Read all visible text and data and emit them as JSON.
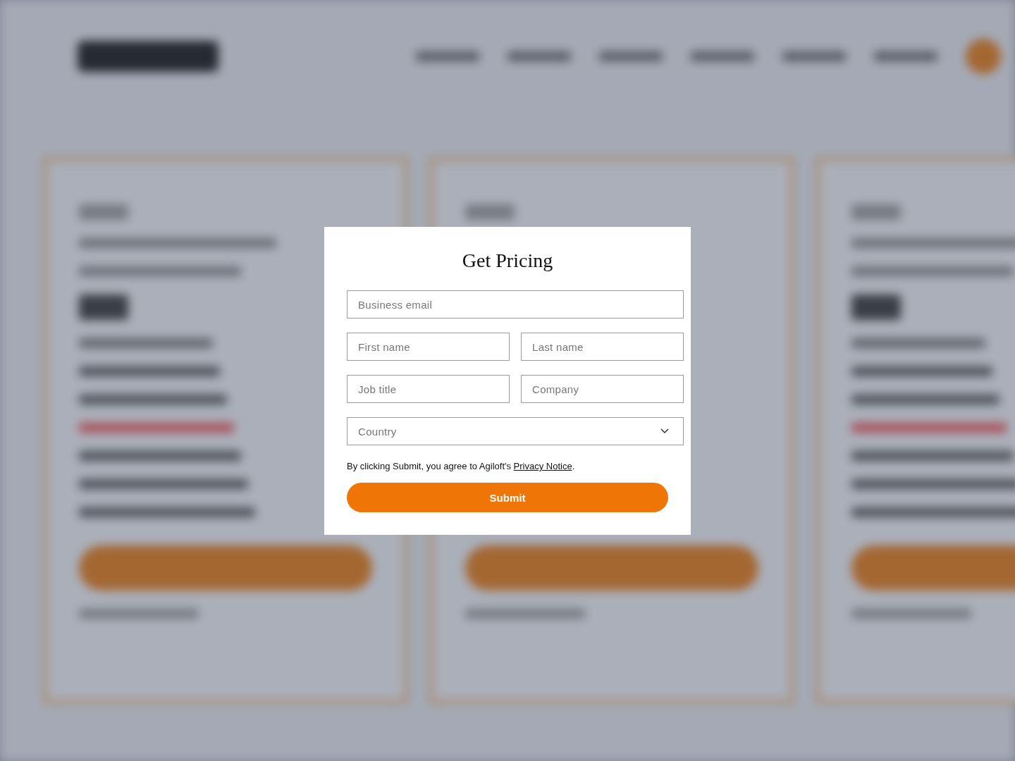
{
  "dialog": {
    "title": "Get Pricing",
    "fields": [
      {
        "placeholder": "Business email",
        "kind": "text"
      },
      {
        "placeholder": "First name",
        "kind": "text"
      },
      {
        "placeholder": "Last name",
        "kind": "text"
      },
      {
        "placeholder": "Job title",
        "kind": "text"
      },
      {
        "placeholder": "Company",
        "kind": "text"
      },
      {
        "placeholder": "Country",
        "kind": "select"
      }
    ],
    "consent": {
      "text": "By clicking Submit, you agree to Agiloft's ",
      "link": "Privacy Notice",
      "after": "."
    },
    "submit": "Submit"
  }
}
